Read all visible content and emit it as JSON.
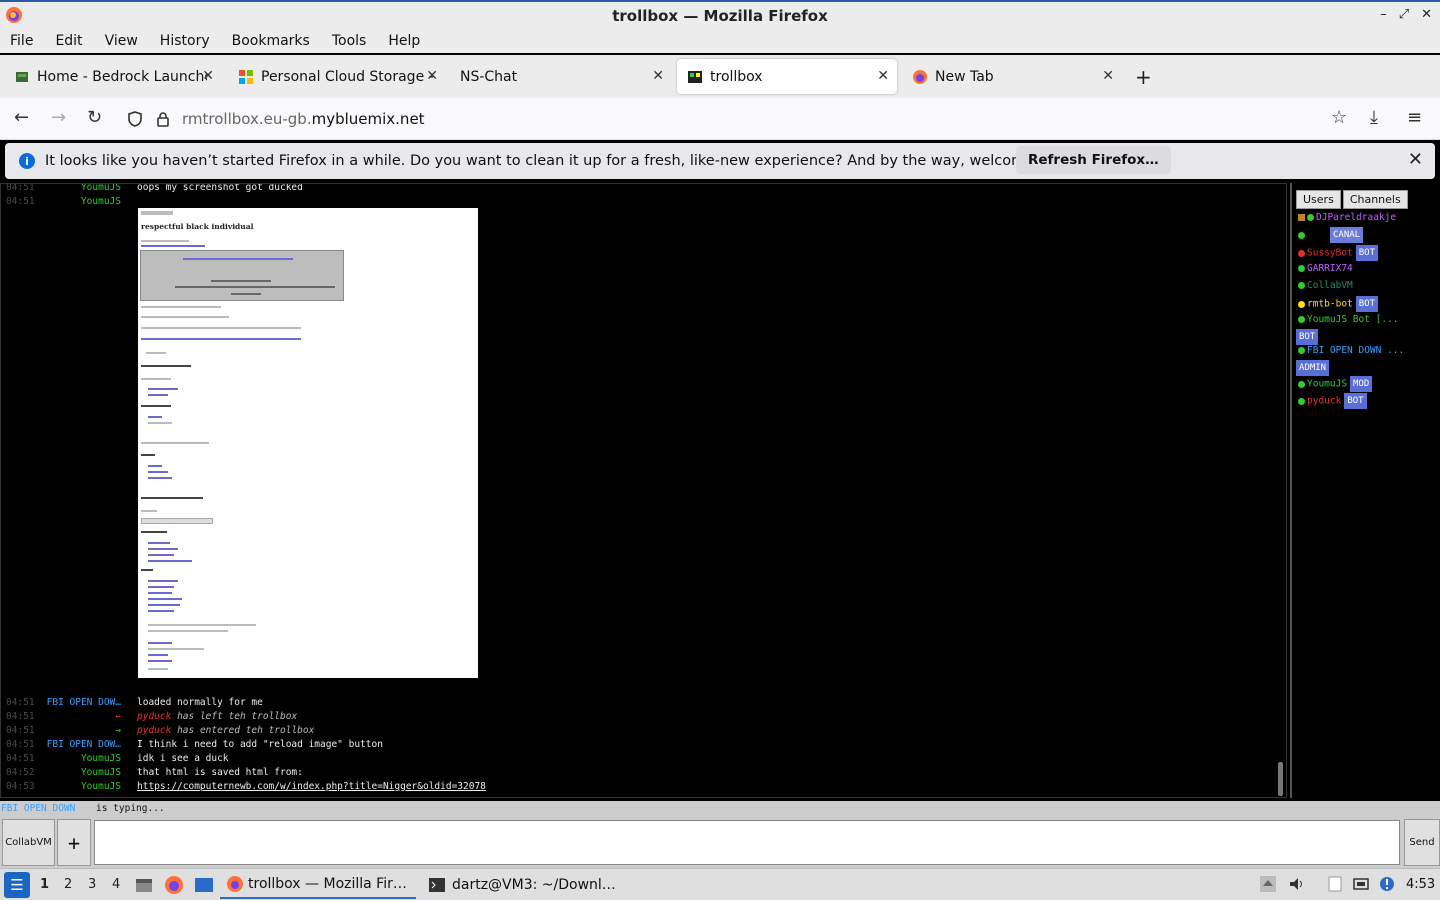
{
  "window": {
    "title": "trollbox — Mozilla Firefox",
    "controls": [
      "–",
      "⤢",
      "✕"
    ]
  },
  "menu": [
    "File",
    "Edit",
    "View",
    "History",
    "Bookmarks",
    "Tools",
    "Help"
  ],
  "tabs": [
    {
      "label": "Home - Bedrock Launcher",
      "active": false
    },
    {
      "label": "Personal Cloud Storage - ",
      "active": false
    },
    {
      "label": "NS-Chat",
      "active": false
    },
    {
      "label": "trollbox",
      "active": true
    },
    {
      "label": "New Tab",
      "active": false
    }
  ],
  "nav": {
    "url_prefix": "rmtrollbox.eu-gb.",
    "url_host": "mybluemix.net"
  },
  "notification": {
    "text": "It looks like you haven’t started Firefox in a while. Do you want to clean it up for a fresh, like-new experience? And by the way, welcome back!",
    "button": "Refresh Firefox…"
  },
  "chat": {
    "top_messages": [
      {
        "time": "04:51",
        "nick": "YoumuJS",
        "text": "oops my screenshot got ducked"
      },
      {
        "time": "04:51",
        "nick": "YoumuJS",
        "text": ""
      }
    ],
    "screenshot_title": "respectful black individual",
    "messages": [
      {
        "time": "04:51",
        "nick": "FBI OPEN DOW…",
        "nick_color": "blue",
        "text": "loaded normally for me",
        "system": false
      },
      {
        "time": "04:51",
        "nick": "←",
        "nick_color": "red",
        "who": "pyduck",
        "text": "has left teh trollbox",
        "system": true
      },
      {
        "time": "04:51",
        "nick": "→",
        "nick_color": "green",
        "who": "pyduck",
        "text": "has entered teh trollbox",
        "system": true
      },
      {
        "time": "04:51",
        "nick": "FBI OPEN DOW…",
        "nick_color": "blue",
        "text": "I think i need to add \"reload image\" button",
        "system": false
      },
      {
        "time": "04:51",
        "nick": "YoumuJS",
        "nick_color": "green",
        "text": "idk i see a duck",
        "system": false
      },
      {
        "time": "04:52",
        "nick": "YoumuJS",
        "nick_color": "green",
        "text": "that html is saved html from:",
        "system": false
      },
      {
        "time": "04:53",
        "nick": "YoumuJS",
        "nick_color": "green",
        "text": "https://computernewb.com/w/index.php?title=Nigger&oldid=32078",
        "system": false,
        "link": true
      }
    ],
    "typing_user": "FBI OPEN DOWN",
    "typing_text": "is typing..."
  },
  "sidebar": {
    "tabs": [
      "Users",
      "Channels"
    ],
    "users": [
      {
        "name": "DJPareldraakje",
        "color": "#c060ff",
        "dot": "#3c3",
        "badge": ""
      },
      {
        "name": "",
        "color": "#3030ff",
        "dot": "#3c3",
        "badge": "CANAL"
      },
      {
        "name": "SussyBot",
        "color": "#e03030",
        "dot": "#e03030",
        "badge": "BOT"
      },
      {
        "name": "GARRIX74",
        "color": "#c060ff",
        "dot": "#3c3",
        "badge": ""
      },
      {
        "name": "CollabVM",
        "color": "#2a8a6a",
        "dot": "#3c3",
        "badge": ""
      },
      {
        "name": "rmtb-bot",
        "color": "#ffe000",
        "dot": "#ffe000",
        "badge": "BOT"
      },
      {
        "name": "YoumuJS Bot [...",
        "color": "#3c3",
        "dot": "#3c3",
        "badge": "BOT"
      },
      {
        "name": "FBI OPEN DOWN ...",
        "color": "#38a0ff",
        "dot": "#3c3",
        "badge": "ADMIN"
      },
      {
        "name": "YoumuJS",
        "color": "#3c3",
        "dot": "#3c3",
        "badge": "MOD"
      },
      {
        "name": "pyduck",
        "color": "#e03030",
        "dot": "#3c3",
        "badge": "BOT"
      }
    ]
  },
  "input": {
    "channel_button": "CollabVM",
    "plus": "+",
    "send": "Send"
  },
  "taskbar": {
    "workspaces": [
      "1",
      "2",
      "3",
      "4"
    ],
    "tasks": [
      {
        "label": "trollbox — Mozilla Fir…",
        "active": true
      },
      {
        "label": "dartz@VM3: ~/Downl…",
        "active": false
      }
    ],
    "clock": "4:53"
  }
}
